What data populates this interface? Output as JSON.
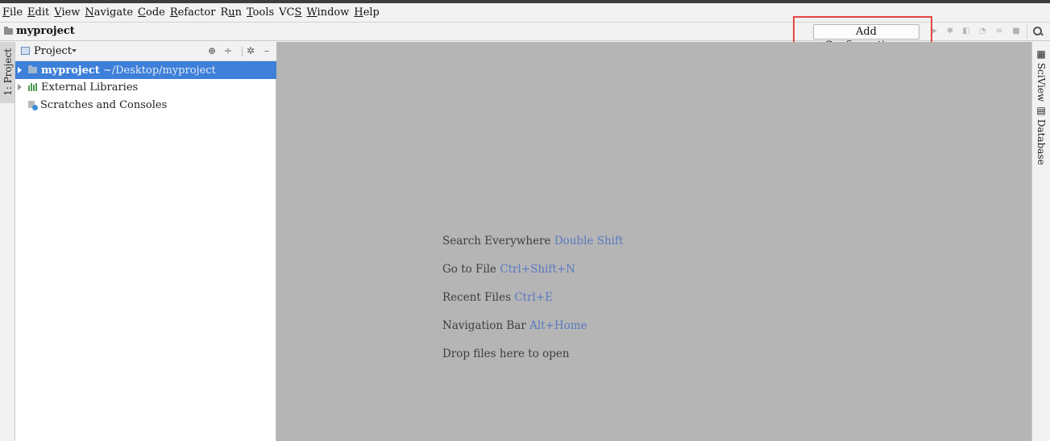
{
  "menubar": {
    "items": [
      {
        "pre": "",
        "ul": "F",
        "post": "ile"
      },
      {
        "pre": "",
        "ul": "E",
        "post": "dit"
      },
      {
        "pre": "",
        "ul": "V",
        "post": "iew"
      },
      {
        "pre": "",
        "ul": "N",
        "post": "avigate"
      },
      {
        "pre": "",
        "ul": "C",
        "post": "ode"
      },
      {
        "pre": "",
        "ul": "R",
        "post": "efactor"
      },
      {
        "pre": "R",
        "ul": "u",
        "post": "n"
      },
      {
        "pre": "",
        "ul": "T",
        "post": "ools"
      },
      {
        "pre": "VC",
        "ul": "S",
        "post": ""
      },
      {
        "pre": "",
        "ul": "W",
        "post": "indow"
      },
      {
        "pre": "",
        "ul": "H",
        "post": "elp"
      }
    ]
  },
  "navbar": {
    "breadcrumb": "myproject",
    "add_configuration": "Add Configuration..."
  },
  "left_strip": {
    "tab_label": "1: Project"
  },
  "project_panel": {
    "title": "Project",
    "tree": {
      "root_name": "myproject",
      "root_path": "~/Desktop/myproject",
      "external_libraries": "External Libraries",
      "scratches": "Scratches and Consoles"
    }
  },
  "editor": {
    "hints": [
      {
        "text": "Search Everywhere",
        "key": "Double Shift"
      },
      {
        "text": "Go to File",
        "key": "Ctrl+Shift+N"
      },
      {
        "text": "Recent Files",
        "key": "Ctrl+E"
      },
      {
        "text": "Navigation Bar",
        "key": "Alt+Home"
      },
      {
        "text": "Drop files here to open",
        "key": ""
      }
    ]
  },
  "right_strip": {
    "sciview": "SciView",
    "database": "Database"
  },
  "colors": {
    "selection": "#3d7fd9",
    "editor_bg": "#b5b5b5",
    "shortcut": "#5a7ac2",
    "highlight": "#e34545"
  }
}
